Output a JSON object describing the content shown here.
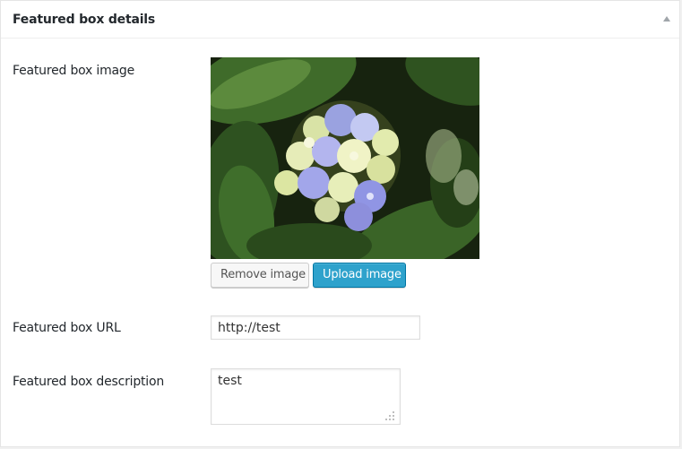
{
  "metabox": {
    "title": "Featured box details",
    "toggle_icon": "triangle-up-icon"
  },
  "fields": {
    "image": {
      "label": "Featured box image",
      "image_subject": "hydrangea flower with green leaves",
      "remove_label": "Remove image",
      "upload_label": "Upload image"
    },
    "url": {
      "label": "Featured box URL",
      "value": "http://test"
    },
    "description": {
      "label": "Featured box description",
      "value": "test"
    }
  },
  "colors": {
    "primary_button": "#2ea2cc",
    "primary_button_border": "#0074a2",
    "secondary_button": "#f7f7f7",
    "panel_background": "#ffffff",
    "page_background": "#f1f1f1"
  }
}
